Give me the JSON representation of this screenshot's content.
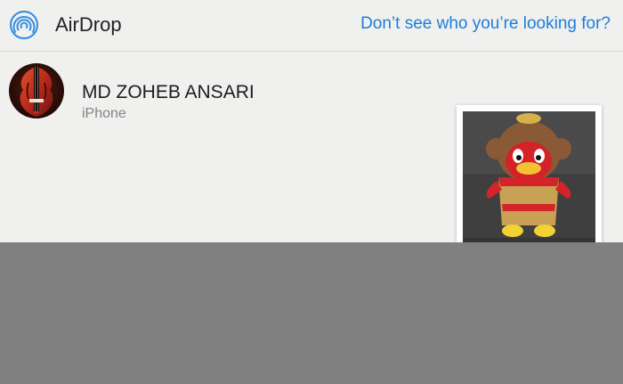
{
  "header": {
    "title": "AirDrop",
    "help_link": "Don’t see who you’re looking for?",
    "icon": "airdrop-icon",
    "accent_color": "#1e7ed8"
  },
  "recipient": {
    "name": "MD ZOHEB ANSARI",
    "device": "iPhone",
    "avatar_icon": "violin-avatar"
  },
  "attachment": {
    "icon": "photo-thumbnail"
  }
}
